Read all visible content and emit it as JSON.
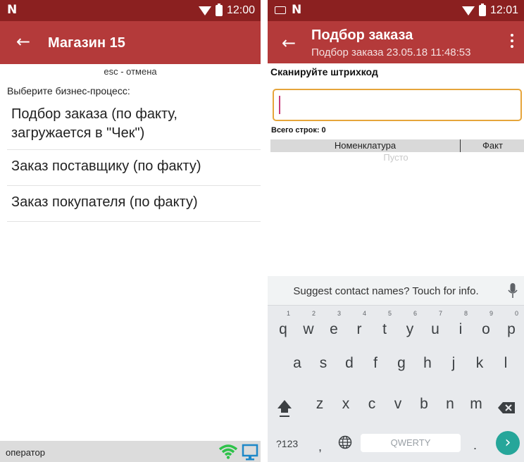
{
  "colors": {
    "status_bar": "#8b2020",
    "toolbar": "#b43a3a",
    "input_border": "#e6a53b",
    "caret": "#c83a7a",
    "enter_key": "#26a69a",
    "signal": "#2ec24a",
    "pc_icon": "#1e88c8"
  },
  "left": {
    "status": {
      "time": "12:00"
    },
    "toolbar": {
      "title": "Магазин 15"
    },
    "esc_hint": "esc - отмена",
    "prompt": "Выберите бизнес-процесс:",
    "processes": [
      {
        "line1": "Подбор заказа (по факту,",
        "line2": "загружается в \"Чек\")"
      },
      {
        "label": "Заказ поставщику (по факту)"
      },
      {
        "label": "Заказ покупателя (по факту)"
      }
    ],
    "bottom_bar": {
      "operator": "оператор"
    }
  },
  "right": {
    "status": {
      "time": "12:01"
    },
    "toolbar": {
      "title": "Подбор заказа",
      "subtitle": "Подбор заказа 23.05.18 11:48:53"
    },
    "scan_label": "Сканируйте штрихкод",
    "scan_input_value": "",
    "rows_count": "Всего строк: 0",
    "table": {
      "columns": [
        "Номенклатура",
        "Факт"
      ],
      "empty_text": "Пусто"
    },
    "keyboard": {
      "suggestion": "Suggest contact names? Touch for info.",
      "row1": [
        {
          "k": "q",
          "h": "1"
        },
        {
          "k": "w",
          "h": "2"
        },
        {
          "k": "e",
          "h": "3"
        },
        {
          "k": "r",
          "h": "4"
        },
        {
          "k": "t",
          "h": "5"
        },
        {
          "k": "y",
          "h": "6"
        },
        {
          "k": "u",
          "h": "7"
        },
        {
          "k": "i",
          "h": "8"
        },
        {
          "k": "o",
          "h": "9"
        },
        {
          "k": "p",
          "h": "0"
        }
      ],
      "row2": [
        "a",
        "s",
        "d",
        "f",
        "g",
        "h",
        "j",
        "k",
        "l"
      ],
      "row3": [
        "z",
        "x",
        "c",
        "v",
        "b",
        "n",
        "m"
      ],
      "sym_label": "?123",
      "comma": ",",
      "space_label": "QWERTY",
      "period": ".",
      "enter_glyph": "›"
    }
  }
}
